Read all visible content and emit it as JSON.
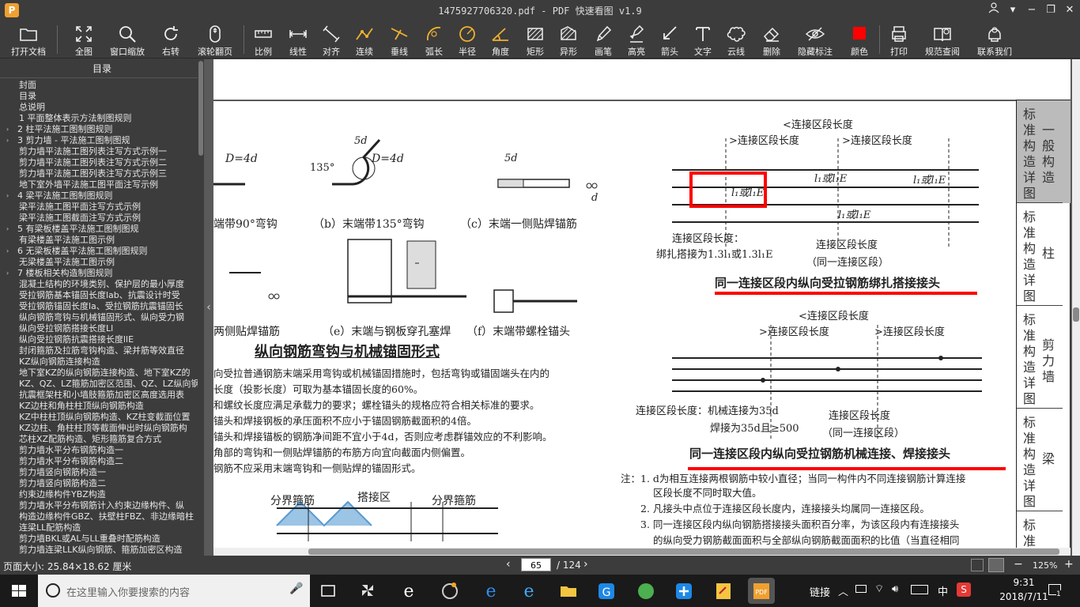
{
  "window": {
    "title": "1475927706320.pdf - PDF 快速看图 v1.9",
    "logo": "P"
  },
  "toolbar": {
    "open": "打开文档",
    "fit": "全图",
    "zoom_window": "窗口缩放",
    "rotate": "右转",
    "scroll_page": "滚轮翻页",
    "scale": "比例",
    "linear": "线性",
    "align": "对齐",
    "continuous": "连续",
    "vertical": "垂线",
    "arc": "弧长",
    "radius": "半径",
    "angle": "角度",
    "rect": "矩形",
    "shape": "异形",
    "pen": "画笔",
    "highlight": "高亮",
    "arrow": "箭头",
    "text": "文字",
    "cloud": "云线",
    "delete": "删除",
    "hide_marks": "隐藏标注",
    "color": "颜色",
    "print": "打印",
    "standard": "规范查阅",
    "contact": "联系我们",
    "color_value": "#ff0000"
  },
  "sidebar": {
    "title": "目录",
    "items": [
      {
        "label": "封面",
        "lv": 1,
        "arrow": ""
      },
      {
        "label": "目录",
        "lv": 1,
        "arrow": ""
      },
      {
        "label": "总说明",
        "lv": 1,
        "arrow": ""
      },
      {
        "label": "1 平面整体表示方法制图规则",
        "lv": 1,
        "arrow": ""
      },
      {
        "label": "2 柱平法施工图制图规则",
        "lv": 1,
        "arrow": "›"
      },
      {
        "label": "3 剪力墙 - 平法施工图制图规",
        "lv": 1,
        "arrow": "›"
      },
      {
        "label": "剪力墙平法施工图列表注写方式示例一",
        "lv": 2,
        "arrow": ""
      },
      {
        "label": "剪力墙平法施工图列表注写方式示例二",
        "lv": 2,
        "arrow": ""
      },
      {
        "label": "剪力墙平法施工图列表注写方式示例三",
        "lv": 2,
        "arrow": ""
      },
      {
        "label": "地下室外墙平法施工图平面注写示例",
        "lv": 2,
        "arrow": ""
      },
      {
        "label": "4 梁平法施工图制图规则",
        "lv": 1,
        "arrow": "›"
      },
      {
        "label": "梁平法施工图平面注写方式示例",
        "lv": 2,
        "arrow": ""
      },
      {
        "label": "梁平法施工图截面注写方式示例",
        "lv": 2,
        "arrow": ""
      },
      {
        "label": "5 有梁板楼盖平法施工图制图规",
        "lv": 1,
        "arrow": "›"
      },
      {
        "label": "有梁楼盖平法施工图示例",
        "lv": 2,
        "arrow": ""
      },
      {
        "label": "6 无梁板楼盖平法施工图制图规则",
        "lv": 1,
        "arrow": "›"
      },
      {
        "label": "无梁楼盖平法施工图示例",
        "lv": 2,
        "arrow": ""
      },
      {
        "label": "7 楼板相关构造制图规则",
        "lv": 1,
        "arrow": "›"
      },
      {
        "label": "混凝土结构的环境类别、保护层的最小厚度",
        "lv": 2,
        "arrow": ""
      },
      {
        "label": "受拉钢筋基本锚固长度lab、抗震设计时受",
        "lv": 2,
        "arrow": ""
      },
      {
        "label": "受拉钢筋锚固长度la、受拉钢筋抗震锚固长",
        "lv": 2,
        "arrow": ""
      },
      {
        "label": "纵向钢筋弯钩与机械锚固形式、纵向受力钢",
        "lv": 2,
        "arrow": ""
      },
      {
        "label": "纵向受拉钢筋搭接长度Ll",
        "lv": 2,
        "arrow": ""
      },
      {
        "label": "纵向受拉钢筋抗震搭接长度llE",
        "lv": 2,
        "arrow": ""
      },
      {
        "label": "封闭箍筋及拉筋弯钩构造、梁并筋等效直径",
        "lv": 2,
        "arrow": ""
      },
      {
        "label": "KZ纵向钢筋连接构造",
        "lv": 2,
        "arrow": ""
      },
      {
        "label": "地下室KZ的纵向钢筋连接构造、地下室KZ的",
        "lv": 2,
        "arrow": ""
      },
      {
        "label": "KZ、QZ、LZ箍筋加密区范围、QZ、LZ纵向钢",
        "lv": 2,
        "arrow": ""
      },
      {
        "label": "抗震框架柱和小墙肢箍筋加密区高度选用表",
        "lv": 2,
        "arrow": ""
      },
      {
        "label": "KZ边柱和角柱柱顶纵向钢筋构造",
        "lv": 2,
        "arrow": ""
      },
      {
        "label": "KZ中柱柱顶纵向钢筋构造、KZ柱变截面位置",
        "lv": 2,
        "arrow": ""
      },
      {
        "label": "KZ边柱、角柱柱顶等截面伸出时纵向钢筋构",
        "lv": 2,
        "arrow": ""
      },
      {
        "label": "芯柱XZ配筋构造、矩形箍筋复合方式",
        "lv": 2,
        "arrow": ""
      },
      {
        "label": "剪力墙水平分布钢筋构造一",
        "lv": 2,
        "arrow": ""
      },
      {
        "label": "剪力墙水平分布钢筋构造二",
        "lv": 2,
        "arrow": ""
      },
      {
        "label": "剪力墙竖向钢筋构造一",
        "lv": 2,
        "arrow": ""
      },
      {
        "label": "剪力墙竖向钢筋构造二",
        "lv": 2,
        "arrow": ""
      },
      {
        "label": "约束边缘构件YBZ构造",
        "lv": 2,
        "arrow": ""
      },
      {
        "label": "剪力墙水平分布钢筋计入约束边缘构件、纵",
        "lv": 2,
        "arrow": ""
      },
      {
        "label": "构造边缘构件GBZ、扶壁柱FBZ、非边缘暗柱",
        "lv": 2,
        "arrow": ""
      },
      {
        "label": "连梁LL配筋构造",
        "lv": 2,
        "arrow": ""
      },
      {
        "label": "剪力墙BKL或AL与LL重叠时配筋构造",
        "lv": 2,
        "arrow": ""
      },
      {
        "label": "剪力墙连梁LLK纵向钢筋、箍筋加密区构造",
        "lv": 2,
        "arrow": ""
      }
    ]
  },
  "doc": {
    "anchor_title": "纵向钢筋弯钩与机械锚固形式",
    "hook_a": "端带90°弯钩",
    "hook_b": "（b）末端带135°弯钩",
    "hook_c": "（c）末端一侧贴焊锚筋",
    "hook_d": "两侧贴焊锚筋",
    "hook_e": "（e）末端与钢板穿孔塞焊",
    "hook_f": "（f）末端带螺栓锚头",
    "dim_d4d_1": "D=4d",
    "dim_d4d_2": "D=4d",
    "dim_135": "135°",
    "dim_5d_1": "5d",
    "dim_5d_2": "5d",
    "dim_d": "d",
    "notes": [
      "向受拉普通钢筋末端采用弯钩或机械锚固措施时，包括弯钩或锚固端头在内的",
      "长度（投影长度）可取为基本锚固长度的60%。",
      "和螺纹长度应满足承载力的要求；螺栓锚头的规格应符合相关标准的要求。",
      "锚头和焊接钢板的承压面积不应小于锚固钢筋截面积的4倍。",
      "锚头和焊接锚板的钢筋净间距不宜小于4d，否则应考虑群锚效应的不利影响。",
      "角部的弯钩和一侧贴焊锚筋的布筋方向宜向截面内侧偏置。",
      "钢筋不应采用末端弯钩和一侧贴焊的锚固形式。"
    ],
    "lap_total": "<连接区段长度",
    "lap_seg1": ">连接区段长度",
    "lap_seg2": ">连接区段长度",
    "lap_l1": "l₁或l₁E",
    "lap_l2": "l₁或l₁E",
    "lap_l3": "l₁或l₁E",
    "lap_l4": "l₁或l₁E",
    "lap_note1": "连接区段长度：",
    "lap_note2": "绑扎搭接为1.3l₁或1.3l₁E",
    "lap_note3": "连接区段长度",
    "lap_note4": "（同一连接区段）",
    "lap_title": "同一连接区段内纵向受拉钢筋绑扎搭接接头",
    "mech_total": "<连接区段长度",
    "mech_seg1": ">连接区段长度",
    "mech_seg2": ">连接区段长度",
    "mech_note1": "连接区段长度：机械连接为35d",
    "mech_note2": "焊接为35d且≥500",
    "mech_note3": "连接区段长度",
    "mech_note4": "（同一连接区段）",
    "mech_title": "同一连接区段内纵向受拉钢筋机械连接、焊接接头",
    "footnote_label": "注：",
    "footnotes": [
      "1. d为相互连接两根钢筋中较小直径；当同一构件内不同连接钢筋计算连接",
      "区段长度不同时取大值。",
      "2. 凡接头中点位于连接区段长度内，连接接头均属同一连接区段。",
      "3. 同一连接区段内纵向钢筋搭接接头面积百分率，为该区段内有连接接头",
      "的纵向受力钢筋截面面积与全部纵向钢筋截面面积的比值（当直径相同"
    ],
    "bottom_left1": "分界箍筋",
    "bottom_mid": "搭接区",
    "bottom_right1": "分界箍筋",
    "side_tabs": [
      {
        "a": "标准构造详图",
        "b": "一般构造"
      },
      {
        "a": "标准构造详图",
        "b": "柱"
      },
      {
        "a": "标准构造详图",
        "b": "剪力墙"
      },
      {
        "a": "标准构造详图",
        "b": "梁"
      },
      {
        "a": "标准",
        "b": ""
      }
    ]
  },
  "status": {
    "page_size": "页面大小: 25.84×18.62 厘米",
    "page_current": "65",
    "page_total": "/ 124",
    "zoom": "125%"
  },
  "taskbar": {
    "search_placeholder": "在这里输入你要搜索的内容",
    "tray_link": "链接",
    "ime": "中",
    "time": "9:31",
    "date": "2018/7/11",
    "notif_count": "1"
  }
}
